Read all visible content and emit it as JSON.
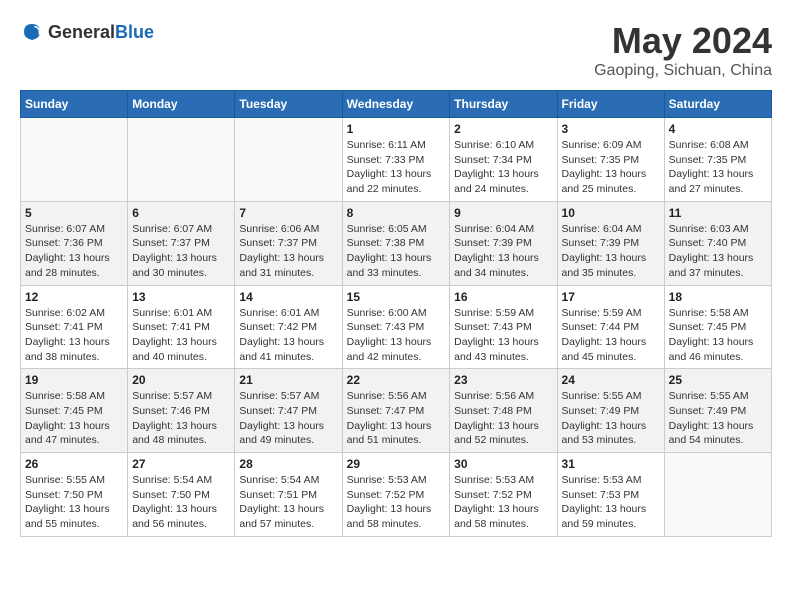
{
  "header": {
    "logo_general": "General",
    "logo_blue": "Blue",
    "month_year": "May 2024",
    "location": "Gaoping, Sichuan, China"
  },
  "weekdays": [
    "Sunday",
    "Monday",
    "Tuesday",
    "Wednesday",
    "Thursday",
    "Friday",
    "Saturday"
  ],
  "weeks": [
    [
      {
        "day": "",
        "sunrise": "",
        "sunset": "",
        "daylight": ""
      },
      {
        "day": "",
        "sunrise": "",
        "sunset": "",
        "daylight": ""
      },
      {
        "day": "",
        "sunrise": "",
        "sunset": "",
        "daylight": ""
      },
      {
        "day": "1",
        "sunrise": "Sunrise: 6:11 AM",
        "sunset": "Sunset: 7:33 PM",
        "daylight": "Daylight: 13 hours and 22 minutes."
      },
      {
        "day": "2",
        "sunrise": "Sunrise: 6:10 AM",
        "sunset": "Sunset: 7:34 PM",
        "daylight": "Daylight: 13 hours and 24 minutes."
      },
      {
        "day": "3",
        "sunrise": "Sunrise: 6:09 AM",
        "sunset": "Sunset: 7:35 PM",
        "daylight": "Daylight: 13 hours and 25 minutes."
      },
      {
        "day": "4",
        "sunrise": "Sunrise: 6:08 AM",
        "sunset": "Sunset: 7:35 PM",
        "daylight": "Daylight: 13 hours and 27 minutes."
      }
    ],
    [
      {
        "day": "5",
        "sunrise": "Sunrise: 6:07 AM",
        "sunset": "Sunset: 7:36 PM",
        "daylight": "Daylight: 13 hours and 28 minutes."
      },
      {
        "day": "6",
        "sunrise": "Sunrise: 6:07 AM",
        "sunset": "Sunset: 7:37 PM",
        "daylight": "Daylight: 13 hours and 30 minutes."
      },
      {
        "day": "7",
        "sunrise": "Sunrise: 6:06 AM",
        "sunset": "Sunset: 7:37 PM",
        "daylight": "Daylight: 13 hours and 31 minutes."
      },
      {
        "day": "8",
        "sunrise": "Sunrise: 6:05 AM",
        "sunset": "Sunset: 7:38 PM",
        "daylight": "Daylight: 13 hours and 33 minutes."
      },
      {
        "day": "9",
        "sunrise": "Sunrise: 6:04 AM",
        "sunset": "Sunset: 7:39 PM",
        "daylight": "Daylight: 13 hours and 34 minutes."
      },
      {
        "day": "10",
        "sunrise": "Sunrise: 6:04 AM",
        "sunset": "Sunset: 7:39 PM",
        "daylight": "Daylight: 13 hours and 35 minutes."
      },
      {
        "day": "11",
        "sunrise": "Sunrise: 6:03 AM",
        "sunset": "Sunset: 7:40 PM",
        "daylight": "Daylight: 13 hours and 37 minutes."
      }
    ],
    [
      {
        "day": "12",
        "sunrise": "Sunrise: 6:02 AM",
        "sunset": "Sunset: 7:41 PM",
        "daylight": "Daylight: 13 hours and 38 minutes."
      },
      {
        "day": "13",
        "sunrise": "Sunrise: 6:01 AM",
        "sunset": "Sunset: 7:41 PM",
        "daylight": "Daylight: 13 hours and 40 minutes."
      },
      {
        "day": "14",
        "sunrise": "Sunrise: 6:01 AM",
        "sunset": "Sunset: 7:42 PM",
        "daylight": "Daylight: 13 hours and 41 minutes."
      },
      {
        "day": "15",
        "sunrise": "Sunrise: 6:00 AM",
        "sunset": "Sunset: 7:43 PM",
        "daylight": "Daylight: 13 hours and 42 minutes."
      },
      {
        "day": "16",
        "sunrise": "Sunrise: 5:59 AM",
        "sunset": "Sunset: 7:43 PM",
        "daylight": "Daylight: 13 hours and 43 minutes."
      },
      {
        "day": "17",
        "sunrise": "Sunrise: 5:59 AM",
        "sunset": "Sunset: 7:44 PM",
        "daylight": "Daylight: 13 hours and 45 minutes."
      },
      {
        "day": "18",
        "sunrise": "Sunrise: 5:58 AM",
        "sunset": "Sunset: 7:45 PM",
        "daylight": "Daylight: 13 hours and 46 minutes."
      }
    ],
    [
      {
        "day": "19",
        "sunrise": "Sunrise: 5:58 AM",
        "sunset": "Sunset: 7:45 PM",
        "daylight": "Daylight: 13 hours and 47 minutes."
      },
      {
        "day": "20",
        "sunrise": "Sunrise: 5:57 AM",
        "sunset": "Sunset: 7:46 PM",
        "daylight": "Daylight: 13 hours and 48 minutes."
      },
      {
        "day": "21",
        "sunrise": "Sunrise: 5:57 AM",
        "sunset": "Sunset: 7:47 PM",
        "daylight": "Daylight: 13 hours and 49 minutes."
      },
      {
        "day": "22",
        "sunrise": "Sunrise: 5:56 AM",
        "sunset": "Sunset: 7:47 PM",
        "daylight": "Daylight: 13 hours and 51 minutes."
      },
      {
        "day": "23",
        "sunrise": "Sunrise: 5:56 AM",
        "sunset": "Sunset: 7:48 PM",
        "daylight": "Daylight: 13 hours and 52 minutes."
      },
      {
        "day": "24",
        "sunrise": "Sunrise: 5:55 AM",
        "sunset": "Sunset: 7:49 PM",
        "daylight": "Daylight: 13 hours and 53 minutes."
      },
      {
        "day": "25",
        "sunrise": "Sunrise: 5:55 AM",
        "sunset": "Sunset: 7:49 PM",
        "daylight": "Daylight: 13 hours and 54 minutes."
      }
    ],
    [
      {
        "day": "26",
        "sunrise": "Sunrise: 5:55 AM",
        "sunset": "Sunset: 7:50 PM",
        "daylight": "Daylight: 13 hours and 55 minutes."
      },
      {
        "day": "27",
        "sunrise": "Sunrise: 5:54 AM",
        "sunset": "Sunset: 7:50 PM",
        "daylight": "Daylight: 13 hours and 56 minutes."
      },
      {
        "day": "28",
        "sunrise": "Sunrise: 5:54 AM",
        "sunset": "Sunset: 7:51 PM",
        "daylight": "Daylight: 13 hours and 57 minutes."
      },
      {
        "day": "29",
        "sunrise": "Sunrise: 5:53 AM",
        "sunset": "Sunset: 7:52 PM",
        "daylight": "Daylight: 13 hours and 58 minutes."
      },
      {
        "day": "30",
        "sunrise": "Sunrise: 5:53 AM",
        "sunset": "Sunset: 7:52 PM",
        "daylight": "Daylight: 13 hours and 58 minutes."
      },
      {
        "day": "31",
        "sunrise": "Sunrise: 5:53 AM",
        "sunset": "Sunset: 7:53 PM",
        "daylight": "Daylight: 13 hours and 59 minutes."
      },
      {
        "day": "",
        "sunrise": "",
        "sunset": "",
        "daylight": ""
      }
    ]
  ]
}
